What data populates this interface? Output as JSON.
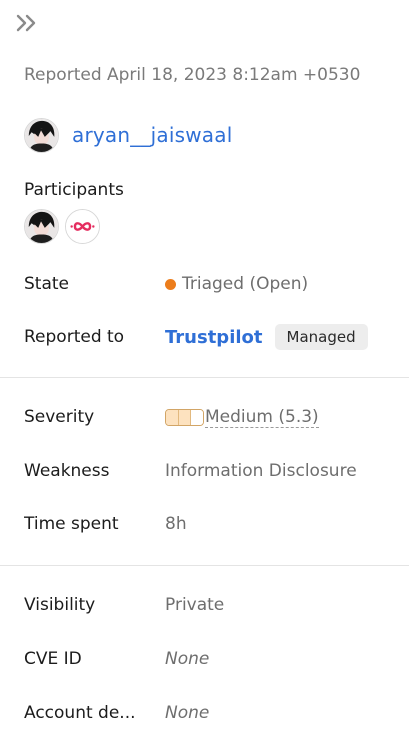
{
  "reported_text": "Reported April 18, 2023 8:12am +0530",
  "reporter": {
    "name": "aryan__jaiswaal"
  },
  "participants": {
    "label": "Participants",
    "count": 2
  },
  "state": {
    "label": "State",
    "value": "Triaged (Open)",
    "color": "#ec7d1c"
  },
  "reported_to": {
    "label": "Reported to",
    "program": "Trustpilot",
    "badge": "Managed"
  },
  "severity": {
    "label": "Severity",
    "value": "Medium (5.3)",
    "level_filled": 2,
    "level_total": 3
  },
  "weakness": {
    "label": "Weakness",
    "value": "Information Disclosure"
  },
  "time_spent": {
    "label": "Time spent",
    "value": "8h"
  },
  "visibility": {
    "label": "Visibility",
    "value": "Private"
  },
  "cve_id": {
    "label": "CVE ID",
    "value": "None"
  },
  "account_details": {
    "label": "Account de...",
    "value": "None"
  },
  "colors": {
    "link": "#2f6fd6",
    "muted": "#6e6e6e",
    "brand_icon": "#e52d5f"
  }
}
